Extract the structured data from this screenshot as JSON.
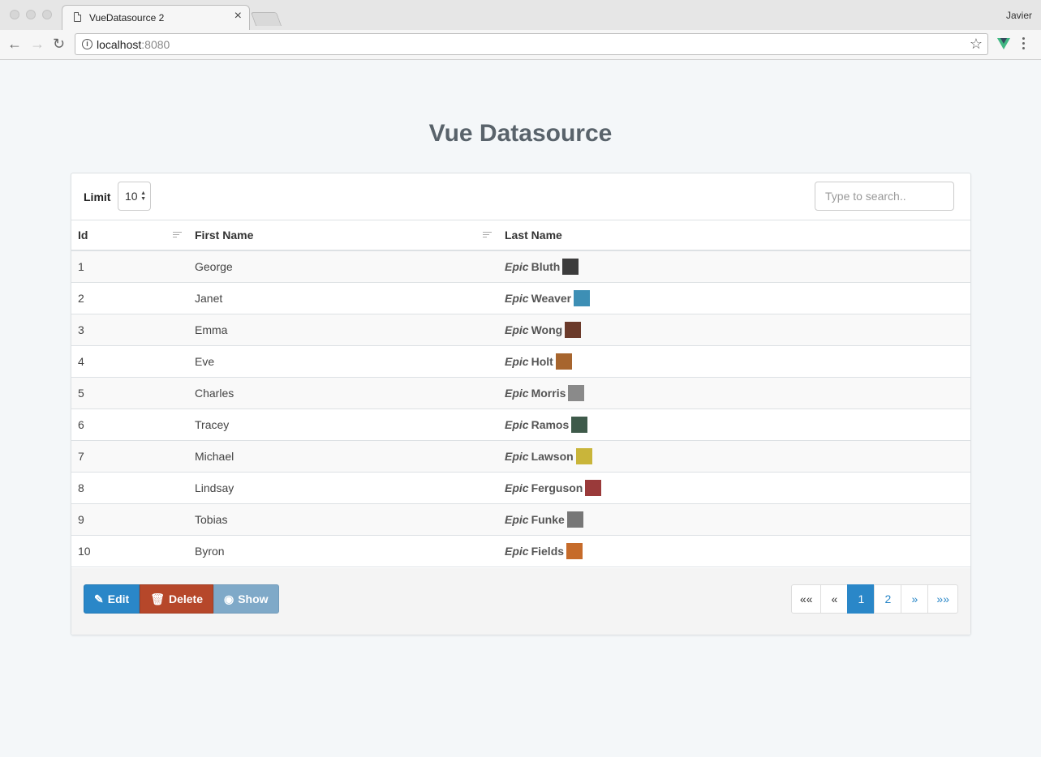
{
  "browser": {
    "tab_title": "VueDatasource 2",
    "profile_name": "Javier",
    "url_host": "localhost",
    "url_port": ":8080"
  },
  "page": {
    "title": "Vue Datasource"
  },
  "controls": {
    "limit_label": "Limit",
    "limit_value": "10",
    "search_placeholder": "Type to search.."
  },
  "table": {
    "columns": [
      "Id",
      "First Name",
      "Last Name"
    ],
    "rows": [
      {
        "id": "1",
        "first": "George",
        "prefix": "Epic",
        "last": "Bluth",
        "avatar_color": "#3c3c3c"
      },
      {
        "id": "2",
        "first": "Janet",
        "prefix": "Epic",
        "last": "Weaver",
        "avatar_color": "#3d8fb5"
      },
      {
        "id": "3",
        "first": "Emma",
        "prefix": "Epic",
        "last": "Wong",
        "avatar_color": "#6b3a2a"
      },
      {
        "id": "4",
        "first": "Eve",
        "prefix": "Epic",
        "last": "Holt",
        "avatar_color": "#a7652e"
      },
      {
        "id": "5",
        "first": "Charles",
        "prefix": "Epic",
        "last": "Morris",
        "avatar_color": "#8a8a8a"
      },
      {
        "id": "6",
        "first": "Tracey",
        "prefix": "Epic",
        "last": "Ramos",
        "avatar_color": "#3e5a4a"
      },
      {
        "id": "7",
        "first": "Michael",
        "prefix": "Epic",
        "last": "Lawson",
        "avatar_color": "#c9b53a"
      },
      {
        "id": "8",
        "first": "Lindsay",
        "prefix": "Epic",
        "last": "Ferguson",
        "avatar_color": "#9a3a3a"
      },
      {
        "id": "9",
        "first": "Tobias",
        "prefix": "Epic",
        "last": "Funke",
        "avatar_color": "#777777"
      },
      {
        "id": "10",
        "first": "Byron",
        "prefix": "Epic",
        "last": "Fields",
        "avatar_color": "#c66b2a"
      }
    ]
  },
  "actions": {
    "edit_label": "Edit",
    "delete_label": "Delete",
    "show_label": "Show"
  },
  "pagination": {
    "first": "««",
    "prev": "«",
    "pages": [
      "1",
      "2"
    ],
    "active_page": "1",
    "next": "»",
    "last": "»»"
  }
}
